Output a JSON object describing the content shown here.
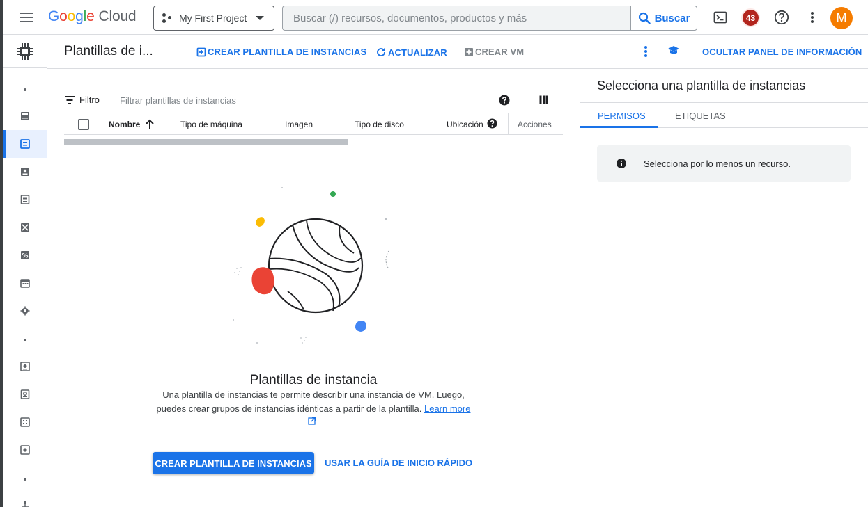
{
  "topbar": {
    "logo_letters": [
      "G",
      "o",
      "o",
      "g",
      "l",
      "e"
    ],
    "logo_cloud": "Cloud",
    "project_name": "My First Project",
    "search_placeholder": "Buscar (/) recursos, documentos, productos y más",
    "search_button": "Buscar",
    "notification_count": "43",
    "avatar_initial": "M"
  },
  "header": {
    "page_title": "Plantillas de i...",
    "actions": {
      "create_template": "CREAR PLANTILLA DE INSTANCIAS",
      "refresh": "ACTUALIZAR",
      "create_vm": "CREAR VM",
      "hide_panel": "OCULTAR PANEL DE INFORMACIÓN"
    }
  },
  "table": {
    "filter_label": "Filtro",
    "filter_placeholder": "Filtrar plantillas de instancias",
    "columns": [
      "Nombre",
      "Tipo de máquina",
      "Imagen",
      "Tipo de disco",
      "Ubicación",
      "Acciones"
    ]
  },
  "empty_state": {
    "title": "Plantillas de instancia",
    "description": "Una plantilla de instancias te permite describir una instancia de VM. Luego, puedes crear grupos de instancias idénticas a partir de la plantilla.",
    "learn_more": "Learn more",
    "primary_button": "CREAR PLANTILLA DE INSTANCIAS",
    "secondary_button": "USAR LA GUÍA DE INICIO RÁPIDO"
  },
  "info_panel": {
    "title": "Selecciona una plantilla de instancias",
    "tabs": [
      "PERMISOS",
      "ETIQUETAS"
    ],
    "active_tab": "PERMISOS",
    "notice": "Selecciona por lo menos un recurso."
  },
  "colors": {
    "accent": "#1a73e8",
    "badge": "#b3261e",
    "avatar": "#f57c00",
    "illustration_yellow": "#fbbc04",
    "illustration_red": "#ea4335",
    "illustration_green": "#34a853",
    "illustration_blue": "#4285f4"
  }
}
